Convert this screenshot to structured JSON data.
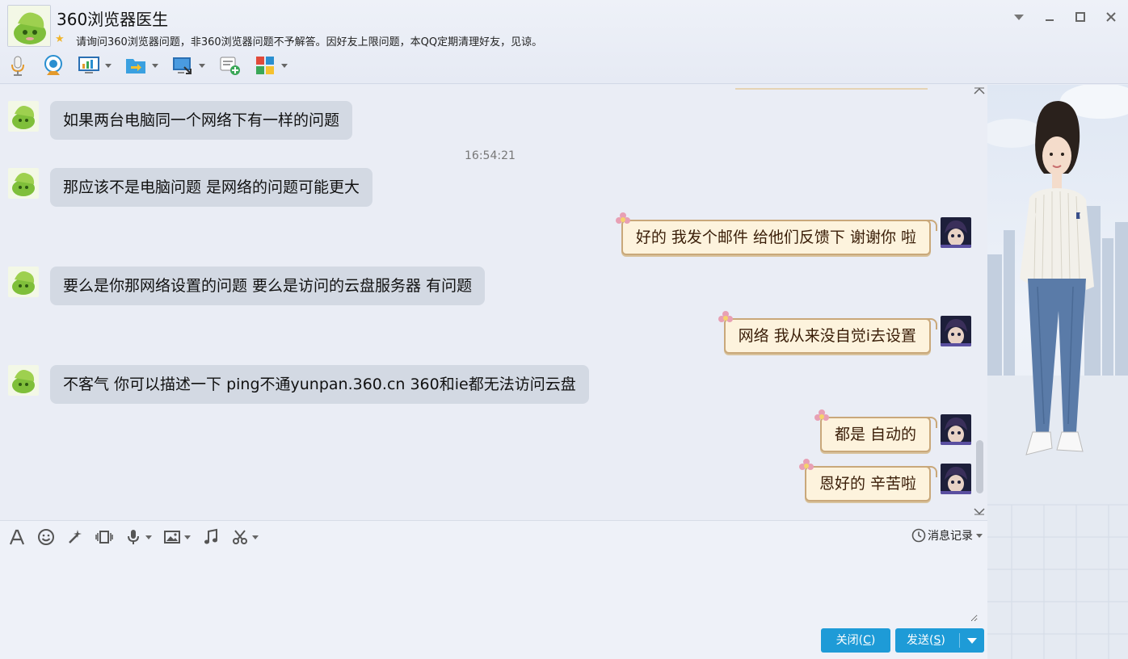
{
  "window": {
    "title": "360浏览器医生",
    "signature": "请询问360浏览器问题，非360浏览器问题不予解答。因好友上限问题，本QQ定期清理好友，见谅。"
  },
  "toolbar_icons": [
    "microphone-icon",
    "webcam-icon",
    "screen-share-icon",
    "file-transfer-icon",
    "remote-desktop-icon",
    "create-discussion-icon",
    "app-grid-icon"
  ],
  "colors": {
    "accent": "#1e9bd7",
    "bubble_left": "#d3d9e3",
    "bubble_right_bg": "#fdf3dd",
    "bubble_right_border": "#c9a87a"
  },
  "chat": {
    "timestamp": "16:54:21",
    "messages": [
      {
        "side": "left",
        "text": "如果两台电脑同一个网络下有一样的问题"
      },
      {
        "side": "left",
        "text": "那应该不是电脑问题 是网络的问题可能更大"
      },
      {
        "side": "right",
        "text": "好的  我发个邮件 给他们反馈下   谢谢你 啦"
      },
      {
        "side": "left",
        "text": "要么是你那网络设置的问题 要么是访问的云盘服务器 有问题"
      },
      {
        "side": "right",
        "text": "网络 我从来没自觉i去设置"
      },
      {
        "side": "left",
        "text": "不客气 你可以描述一下 ping不通yunpan.360.cn 360和ie都无法访问云盘"
      },
      {
        "side": "right",
        "text": "都是 自动的"
      },
      {
        "side": "right",
        "text": "恩好的   辛苦啦"
      }
    ]
  },
  "input": {
    "history_label": "消息记录",
    "close_label": "关闭(",
    "close_key": "C",
    "close_end": ")",
    "send_label": "发送(",
    "send_key": "S",
    "send_end": ")",
    "placeholder": ""
  }
}
